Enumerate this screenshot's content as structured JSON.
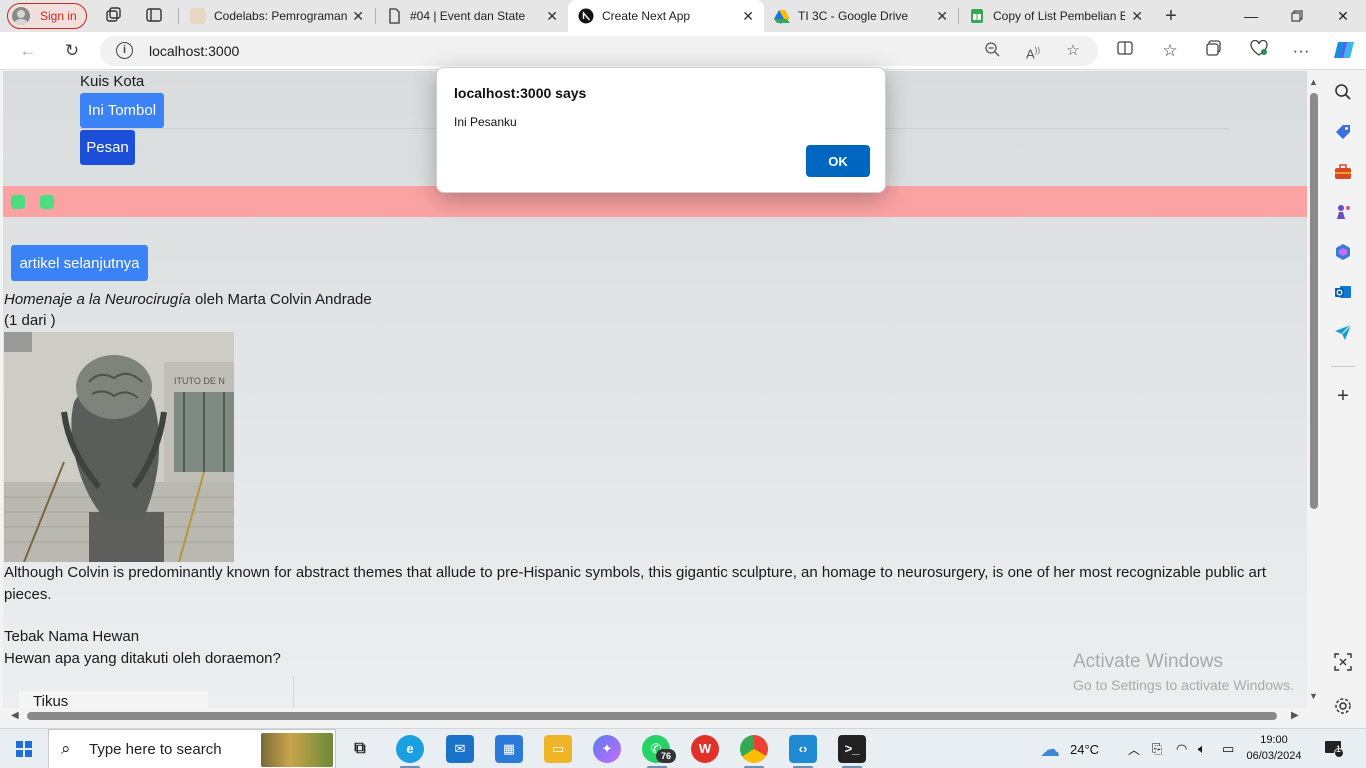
{
  "browser": {
    "signin_label": "Sign in",
    "tabs": [
      {
        "title": "Codelabs: Pemrograman",
        "active": false
      },
      {
        "title": "#04 | Event dan State",
        "active": false
      },
      {
        "title": "Create Next App",
        "active": true
      },
      {
        "title": "TI 3C - Google Drive",
        "active": false
      },
      {
        "title": "Copy of List Pembelian B",
        "active": false
      }
    ],
    "url": "localhost:3000"
  },
  "page": {
    "kuis_title": "Kuis Kota",
    "tombol_label": "Ini Tombol",
    "pesan_label": "Pesan",
    "artikel_button": "artikel selanjutnya",
    "artwork_title": "Homenaje a la Neurocirugía",
    "artwork_by": " oleh Marta Colvin Andrade",
    "artwork_count": "(1 dari )",
    "artwork_description": "Although Colvin is predominantly known for abstract themes that allude to pre-Hispanic symbols, this gigantic sculpture, an homage to neurosurgery, is one of her most recognizable public art pieces.",
    "quiz_title": "Tebak Nama Hewan",
    "quiz_question": "Hewan apa yang ditakuti oleh doraemon?",
    "quiz_answer": "Tikus",
    "watermark_title": "Activate Windows",
    "watermark_sub": "Go to Settings to activate Windows."
  },
  "dialog": {
    "title": "localhost:3000 says",
    "message": "Ini Pesanku",
    "ok_label": "OK"
  },
  "taskbar": {
    "search_placeholder": "Type here to search",
    "whatsapp_badge": "76",
    "weather": "24°C",
    "time": "19:00",
    "date": "06/03/2024",
    "notification_count": "1"
  },
  "colors": {
    "accent_blue": "#3b82f6",
    "dark_blue": "#1d4ed8",
    "pink_bar": "#fba3a3",
    "green_square": "#4ade80",
    "dialog_ok": "#0067c0"
  }
}
